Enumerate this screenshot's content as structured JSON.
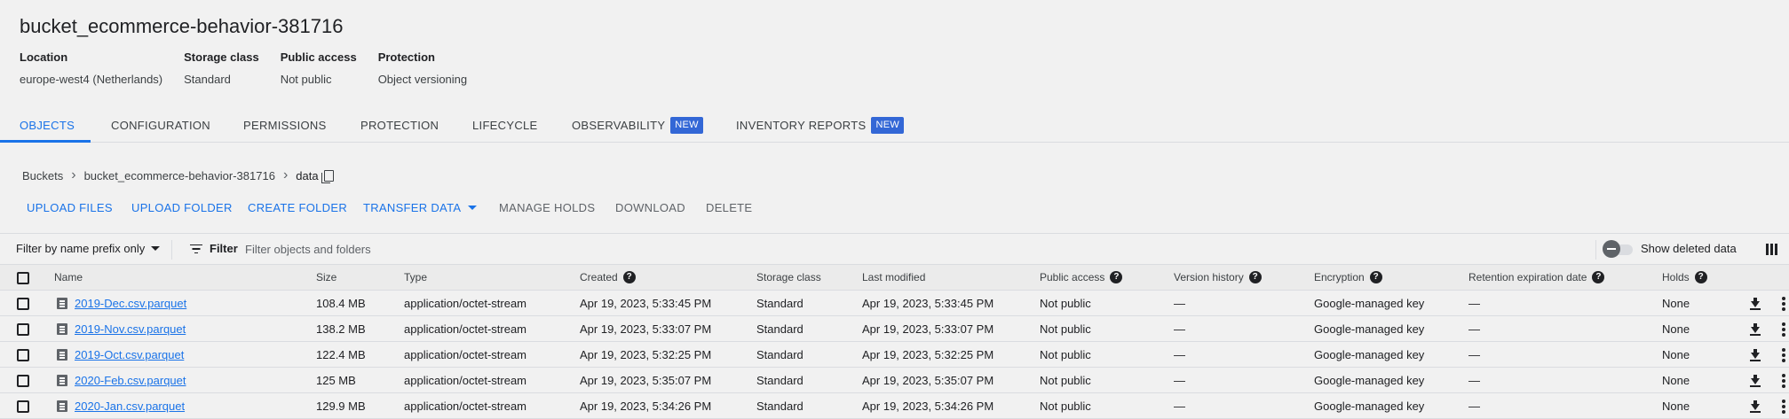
{
  "bucket": {
    "title": "bucket_ecommerce-behavior-381716",
    "meta": [
      {
        "label": "Location",
        "value": "europe-west4 (Netherlands)"
      },
      {
        "label": "Storage class",
        "value": "Standard"
      },
      {
        "label": "Public access",
        "value": "Not public"
      },
      {
        "label": "Protection",
        "value": "Object versioning"
      }
    ]
  },
  "tabs": [
    {
      "label": "OBJECTS",
      "active": true
    },
    {
      "label": "CONFIGURATION"
    },
    {
      "label": "PERMISSIONS"
    },
    {
      "label": "PROTECTION"
    },
    {
      "label": "LIFECYCLE"
    },
    {
      "label": "OBSERVABILITY",
      "badge": "NEW"
    },
    {
      "label": "INVENTORY REPORTS",
      "badge": "NEW"
    }
  ],
  "breadcrumb": {
    "root": "Buckets",
    "bucket": "bucket_ecommerce-behavior-381716",
    "current": "data"
  },
  "actions": {
    "upload_files": "UPLOAD FILES",
    "upload_folder": "UPLOAD FOLDER",
    "create_folder": "CREATE FOLDER",
    "transfer_data": "TRANSFER DATA",
    "manage_holds": "MANAGE HOLDS",
    "download": "DOWNLOAD",
    "delete": "DELETE"
  },
  "filterbar": {
    "prefix_label": "Filter by name prefix only",
    "filter_label": "Filter",
    "placeholder": "Filter objects and folders",
    "show_deleted_label": "Show deleted data"
  },
  "table": {
    "columns": {
      "name": "Name",
      "size": "Size",
      "type": "Type",
      "created": "Created",
      "storage_class": "Storage class",
      "last_modified": "Last modified",
      "public_access": "Public access",
      "version_history": "Version history",
      "encryption": "Encryption",
      "retention": "Retention expiration date",
      "holds": "Holds"
    },
    "rows": [
      {
        "name": "2019-Dec.csv.parquet",
        "size": "108.4 MB",
        "type": "application/octet-stream",
        "created": "Apr 19, 2023, 5:33:45 PM",
        "storage_class": "Standard",
        "last_modified": "Apr 19, 2023, 5:33:45 PM",
        "public_access": "Not public",
        "version_history": "—",
        "encryption": "Google-managed key",
        "retention": "—",
        "holds": "None"
      },
      {
        "name": "2019-Nov.csv.parquet",
        "size": "138.2 MB",
        "type": "application/octet-stream",
        "created": "Apr 19, 2023, 5:33:07 PM",
        "storage_class": "Standard",
        "last_modified": "Apr 19, 2023, 5:33:07 PM",
        "public_access": "Not public",
        "version_history": "—",
        "encryption": "Google-managed key",
        "retention": "—",
        "holds": "None"
      },
      {
        "name": "2019-Oct.csv.parquet",
        "size": "122.4 MB",
        "type": "application/octet-stream",
        "created": "Apr 19, 2023, 5:32:25 PM",
        "storage_class": "Standard",
        "last_modified": "Apr 19, 2023, 5:32:25 PM",
        "public_access": "Not public",
        "version_history": "—",
        "encryption": "Google-managed key",
        "retention": "—",
        "holds": "None"
      },
      {
        "name": "2020-Feb.csv.parquet",
        "size": "125 MB",
        "type": "application/octet-stream",
        "created": "Apr 19, 2023, 5:35:07 PM",
        "storage_class": "Standard",
        "last_modified": "Apr 19, 2023, 5:35:07 PM",
        "public_access": "Not public",
        "version_history": "—",
        "encryption": "Google-managed key",
        "retention": "—",
        "holds": "None"
      },
      {
        "name": "2020-Jan.csv.parquet",
        "size": "129.9 MB",
        "type": "application/octet-stream",
        "created": "Apr 19, 2023, 5:34:26 PM",
        "storage_class": "Standard",
        "last_modified": "Apr 19, 2023, 5:34:26 PM",
        "public_access": "Not public",
        "version_history": "—",
        "encryption": "Google-managed key",
        "retention": "—",
        "holds": "None"
      }
    ]
  }
}
